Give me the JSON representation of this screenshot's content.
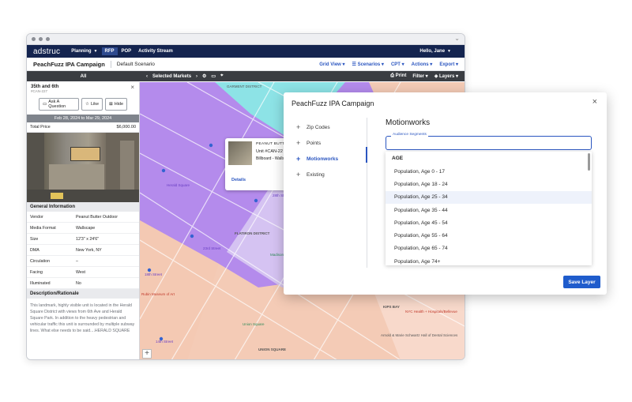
{
  "nav": {
    "logo": "adstruc",
    "items": [
      {
        "label": "Planning",
        "caret": "▼"
      },
      {
        "label": "RFP"
      },
      {
        "label": "POP"
      },
      {
        "label": "Activity Stream"
      }
    ],
    "user": "Hello, Jane",
    "user_caret": "▼"
  },
  "subbar": {
    "campaign": "PeachFuzz IPA Campaign",
    "scenario": "Default Scenario",
    "actions": [
      "Grid View ▾",
      "Scenarios ▾",
      "CPT ▾",
      "Actions ▾",
      "Export ▾"
    ]
  },
  "toolbar": {
    "all": "All",
    "markets": "Selected Markets",
    "print": "Print",
    "filter": "Filter ▾",
    "layers": "Layers ▾"
  },
  "unit_panel": {
    "title": "35th and 6th",
    "subtitle": "#CAN-227",
    "buttons": [
      "Ask A Question",
      "Like",
      "Hide"
    ],
    "date_range": "Feb 28, 2024 to Mar 29, 2024",
    "total_price_label": "Total Price",
    "total_price": "$6,000.00",
    "general_info_heading": "General Information",
    "rows": [
      {
        "key": "Vendor",
        "value": "Peanut Butter Outdoor"
      },
      {
        "key": "Media Format",
        "value": "Wallscape"
      },
      {
        "key": "Size",
        "value": "12'3\" x 24'6\""
      },
      {
        "key": "DMA",
        "value": "New York, NY"
      },
      {
        "key": "Circulation",
        "value": "–"
      },
      {
        "key": "Facing",
        "value": "West"
      },
      {
        "key": "Illuminated",
        "value": "No"
      }
    ],
    "description_heading": "Description/Rationale",
    "description": "This landmark, highly visible unit is located in the Herald Square District with views from 6th Ave and Herald Square Park. In addition to the heavy pedestrian and vehicular traffic this unit is surrounded by multiple subway lines. What else needs to be said....HERALD SQUARE"
  },
  "map": {
    "labels": {
      "garment": "GARMENT DISTRICT",
      "nomad": "NOMAD",
      "flatiron": "FLATIRON DISTRICT",
      "kips": "KIPS BAY",
      "union": "UNION SQUARE",
      "madison": "Madison Square Park",
      "st33": "33rd Street",
      "st28": "28th Street",
      "st23": "23rd Street",
      "st23b": "23rd Street",
      "st18": "18th Street",
      "st14": "14th Street",
      "herald": "Herald Square",
      "rubin": "Rubin Museum of Art",
      "union_sq_label": "Union Square",
      "moma": "NYC Health + Hospitals/Bellevue",
      "amalgamated": "Arnold & Marie Schwartz Hall of Dental Sciences",
      "ny_edition": "New York Edition"
    },
    "popup": {
      "title": "PEANUT BUTTE",
      "unit": "Unit #CAN-22",
      "format": "Billboard - Walls",
      "details": "Details"
    },
    "zoom": "+"
  },
  "modal": {
    "title": "PeachFuzz IPA Campaign",
    "close": "×",
    "options": [
      "Zip Codes",
      "Points",
      "Motionworks",
      "Existing"
    ],
    "heading": "Motionworks",
    "field_label": "Audience Segments",
    "list_heading": "AGE",
    "items": [
      "Population, Age 0 - 17",
      "Population, Age 18 - 24",
      "Population, Age 25 - 34",
      "Population, Age 35 - 44",
      "Population, Age 45 - 54",
      "Population, Age 55 - 64",
      "Population, Age 65 - 74",
      "Population, Age 74+"
    ],
    "save": "Save Layer"
  },
  "colors": {
    "nav_bg": "#14244f",
    "accent": "#1f5ccc",
    "purple_zone": "#b48bec",
    "cyan_zone": "#8de3e6",
    "salmon_zone": "#f4c9b3",
    "lilac_zone": "#d7c6f2"
  }
}
